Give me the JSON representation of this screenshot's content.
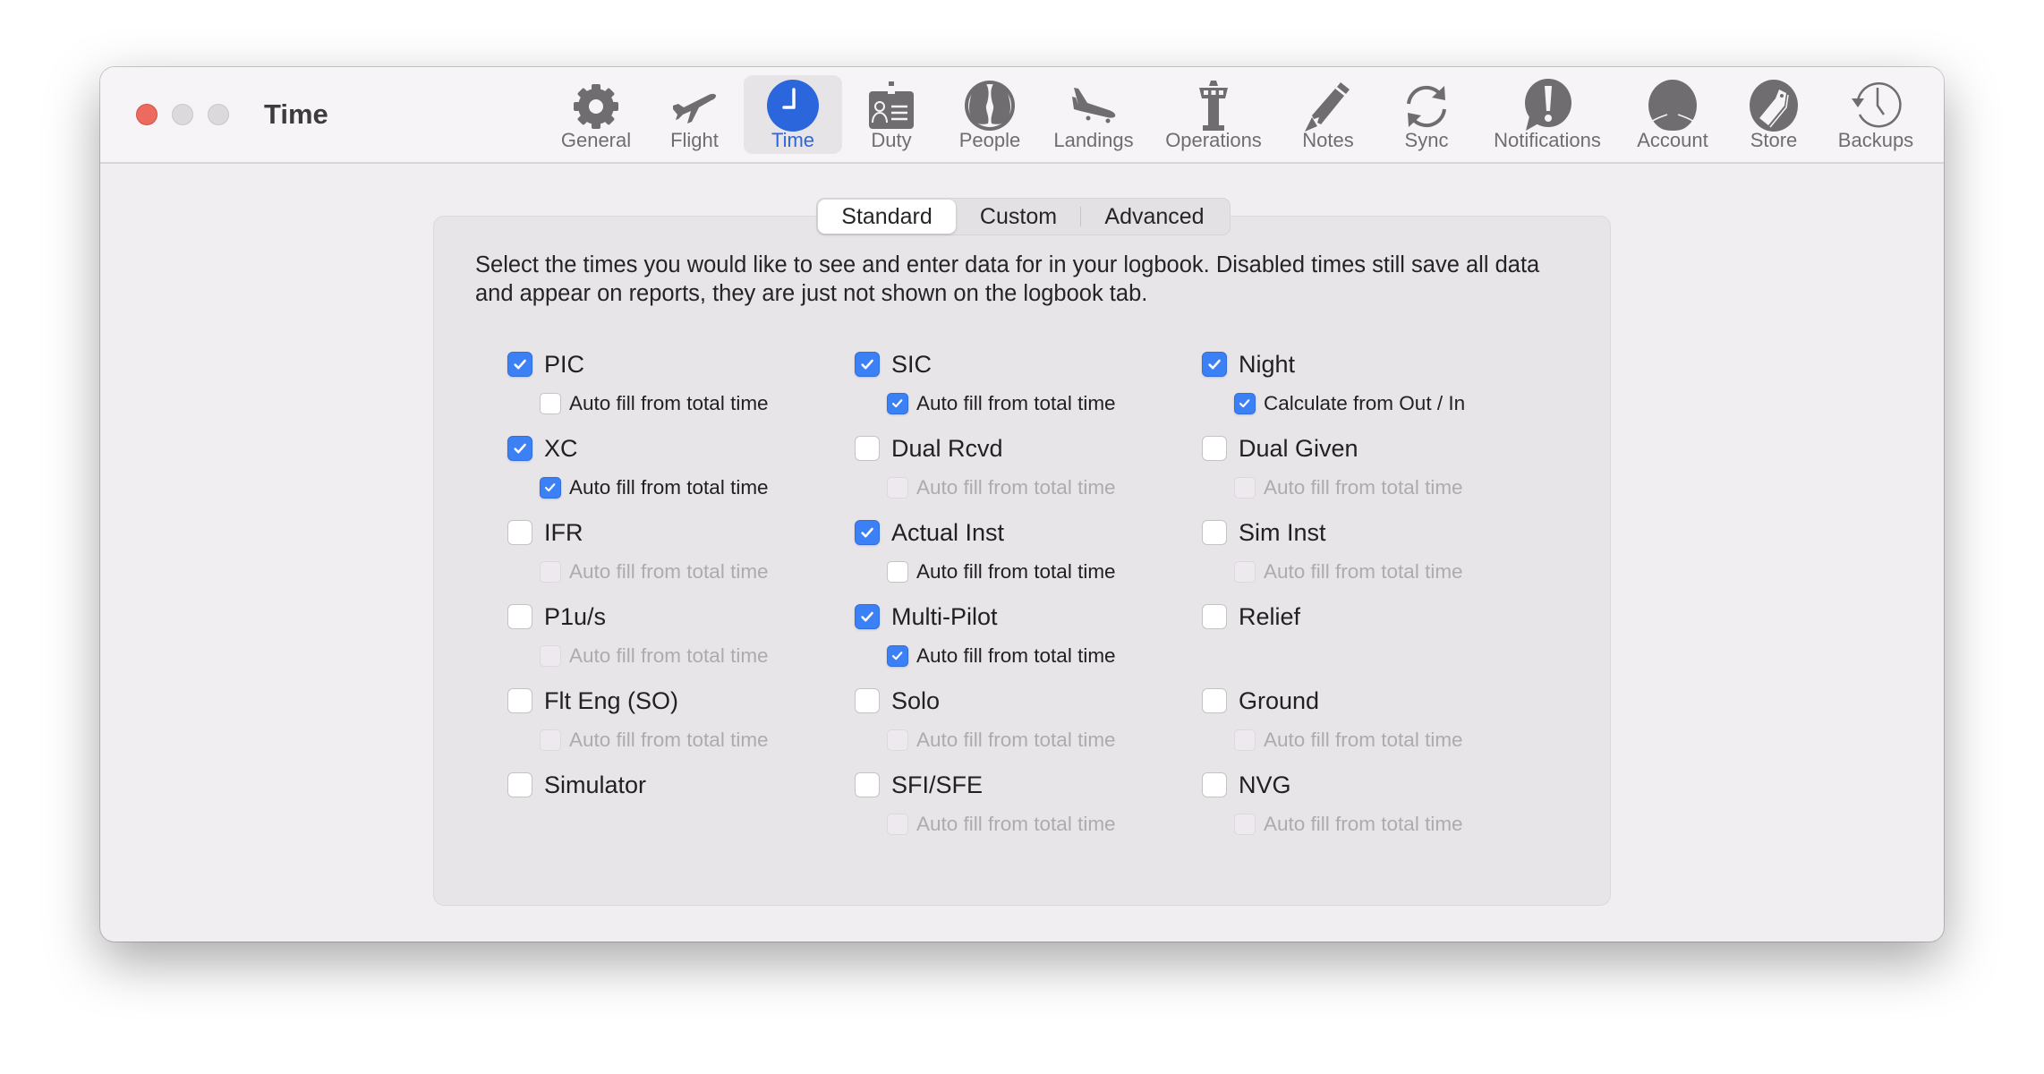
{
  "window": {
    "title": "Time",
    "traffic_lights": [
      "close",
      "minimize",
      "zoom"
    ]
  },
  "toolbar": {
    "selected": "Time",
    "accent_color": "#2c66dd",
    "icon_color": "#6f6d70",
    "items": [
      {
        "label": "General",
        "icon": "gear-icon"
      },
      {
        "label": "Flight",
        "icon": "airplane-takeoff-icon"
      },
      {
        "label": "Time",
        "icon": "clock-icon"
      },
      {
        "label": "Duty",
        "icon": "id-badge-icon"
      },
      {
        "label": "People",
        "icon": "people-icon"
      },
      {
        "label": "Landings",
        "icon": "airplane-landing-icon"
      },
      {
        "label": "Operations",
        "icon": "control-tower-icon"
      },
      {
        "label": "Notes",
        "icon": "pencil-icon"
      },
      {
        "label": "Sync",
        "icon": "sync-icon"
      },
      {
        "label": "Notifications",
        "icon": "exclamation-bubble-icon"
      },
      {
        "label": "Account",
        "icon": "person-icon"
      },
      {
        "label": "Store",
        "icon": "tag-icon"
      },
      {
        "label": "Backups",
        "icon": "time-machine-icon"
      }
    ]
  },
  "segmented": {
    "selected": "Standard",
    "options": [
      "Standard",
      "Custom",
      "Advanced"
    ]
  },
  "intro_text": "Select the times you would like to see and enter data for in your logbook. Disabled times still save all data and appear on reports, they are just not shown on the logbook tab.",
  "columns": [
    [
      {
        "label": "PIC",
        "checked": true,
        "sub": {
          "label": "Auto fill from total time",
          "checked": false,
          "enabled": true
        }
      },
      {
        "label": "XC",
        "checked": true,
        "sub": {
          "label": "Auto fill from total time",
          "checked": true,
          "enabled": true
        }
      },
      {
        "label": "IFR",
        "checked": false,
        "sub": {
          "label": "Auto fill from total time",
          "checked": false,
          "enabled": false
        }
      },
      {
        "label": "P1u/s",
        "checked": false,
        "sub": {
          "label": "Auto fill from total time",
          "checked": false,
          "enabled": false
        }
      },
      {
        "label": "Flt Eng (SO)",
        "checked": false,
        "sub": {
          "label": "Auto fill from total time",
          "checked": false,
          "enabled": false
        }
      },
      {
        "label": "Simulator",
        "checked": false,
        "sub": null
      }
    ],
    [
      {
        "label": "SIC",
        "checked": true,
        "sub": {
          "label": "Auto fill from total time",
          "checked": true,
          "enabled": true
        }
      },
      {
        "label": "Dual Rcvd",
        "checked": false,
        "sub": {
          "label": "Auto fill from total time",
          "checked": false,
          "enabled": false
        }
      },
      {
        "label": "Actual Inst",
        "checked": true,
        "sub": {
          "label": "Auto fill from total time",
          "checked": false,
          "enabled": true
        }
      },
      {
        "label": "Multi-Pilot",
        "checked": true,
        "sub": {
          "label": "Auto fill from total time",
          "checked": true,
          "enabled": true
        }
      },
      {
        "label": "Solo",
        "checked": false,
        "sub": {
          "label": "Auto fill from total time",
          "checked": false,
          "enabled": false
        }
      },
      {
        "label": "SFI/SFE",
        "checked": false,
        "sub": {
          "label": "Auto fill from total time",
          "checked": false,
          "enabled": false
        }
      }
    ],
    [
      {
        "label": "Night",
        "checked": true,
        "sub": {
          "label": "Calculate from Out / In",
          "checked": true,
          "enabled": true
        }
      },
      {
        "label": "Dual Given",
        "checked": false,
        "sub": {
          "label": "Auto fill from total time",
          "checked": false,
          "enabled": false
        }
      },
      {
        "label": "Sim Inst",
        "checked": false,
        "sub": {
          "label": "Auto fill from total time",
          "checked": false,
          "enabled": false
        }
      },
      {
        "label": "Relief",
        "checked": false,
        "sub": null
      },
      {
        "label": "Ground",
        "checked": false,
        "sub": {
          "label": "Auto fill from total time",
          "checked": false,
          "enabled": false
        }
      },
      {
        "label": "NVG",
        "checked": false,
        "sub": {
          "label": "Auto fill from total time",
          "checked": false,
          "enabled": false
        }
      }
    ]
  ]
}
